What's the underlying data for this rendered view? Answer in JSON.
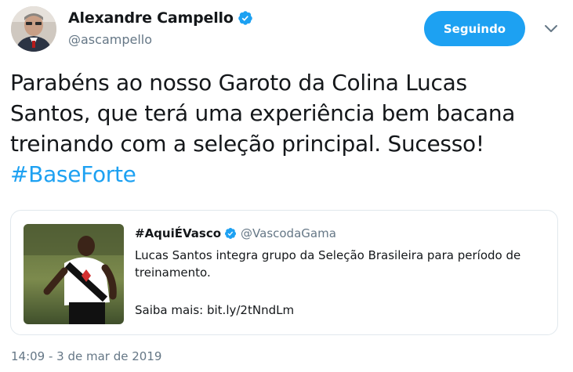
{
  "author": {
    "display_name": "Alexandre Campello",
    "handle": "@ascampello",
    "avatar_icon": "person-avatar-icon",
    "verified_icon": "verified-badge-icon"
  },
  "follow_button": {
    "label": "Seguindo"
  },
  "menu_icon": "chevron-down-icon",
  "tweet": {
    "text_line1": "Parabéns ao nosso Garoto da Colina Lucas",
    "text_line2": "Santos, que terá uma experiência bem bacana",
    "text_line3": "treinando com a seleção principal. Sucesso!",
    "hashtag": "#BaseForte"
  },
  "quoted_tweet": {
    "display_name": "#AquiÉVasco",
    "handle": "@VascodaGama",
    "text_line1": "Lucas Santos integra grupo da Seleção Brasileira para período de",
    "text_line2": "treinamento.",
    "link_prefix": "Saiba mais: ",
    "link": "bit.ly/2tNndLm"
  },
  "timestamp": "14:09 - 3 de mar de 2019",
  "colors": {
    "accent": "#1da1f2",
    "text": "#14171a",
    "secondary": "#657786",
    "border": "#e1e8ed"
  }
}
